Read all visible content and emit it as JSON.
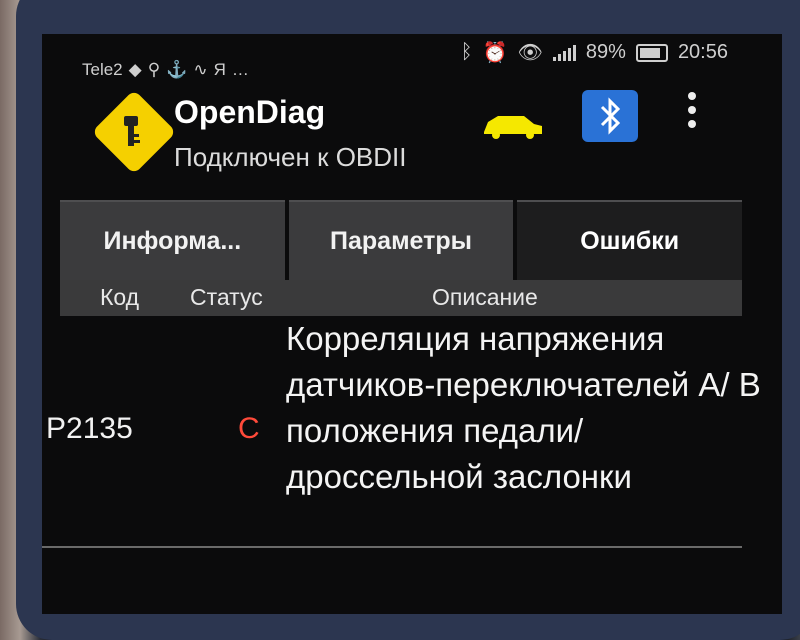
{
  "status_bar": {
    "carrier": "Tele2",
    "yandex_glyph": "Я",
    "more": "…",
    "signal_strength": 0.8,
    "battery": "89%",
    "time": "20:56"
  },
  "app": {
    "title": "OpenDiag",
    "subtitle": "Подключен к OBDII",
    "accent": "#f5d000",
    "bluetooth_color": "#2a72d6",
    "status_error_color": "#ff4a3a"
  },
  "tabs": [
    {
      "label": "Информа...",
      "active": false
    },
    {
      "label": "Параметры",
      "active": false
    },
    {
      "label": "Ошибки",
      "active": true
    }
  ],
  "table": {
    "headers": {
      "code": "Код",
      "status": "Статус",
      "description": "Описание"
    },
    "rows": [
      {
        "code": "P2135",
        "status": "C",
        "description": "Корреляция напряжения датчиков-переключателей A/ B положения педали/ дроссельной заслонки"
      }
    ]
  }
}
